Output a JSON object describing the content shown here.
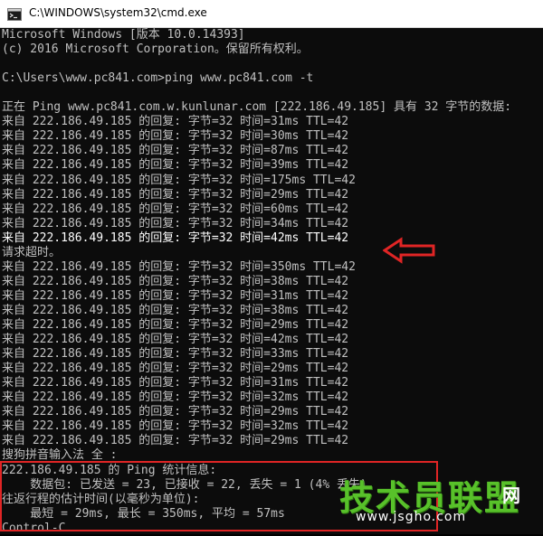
{
  "window": {
    "title": "C:\\WINDOWS\\system32\\cmd.exe",
    "icon": "cmd-icon"
  },
  "console_lines": [
    "Microsoft Windows [版本 10.0.14393]",
    "(c) 2016 Microsoft Corporation。保留所有权利。",
    "",
    "C:\\Users\\www.pc841.com>ping www.pc841.com -t",
    "",
    "正在 Ping www.pc841.com.w.kunlunar.com [222.186.49.185] 具有 32 字节的数据:",
    "来自 222.186.49.185 的回复: 字节=32 时间=31ms TTL=42",
    "来自 222.186.49.185 的回复: 字节=32 时间=30ms TTL=42",
    "来自 222.186.49.185 的回复: 字节=32 时间=87ms TTL=42",
    "来自 222.186.49.185 的回复: 字节=32 时间=39ms TTL=42",
    "来自 222.186.49.185 的回复: 字节=32 时间=175ms TTL=42",
    "来自 222.186.49.185 的回复: 字节=32 时间=29ms TTL=42",
    "来自 222.186.49.185 的回复: 字节=32 时间=60ms TTL=42",
    "来自 222.186.49.185 的回复: 字节=32 时间=34ms TTL=42",
    "来自 222.186.49.185 的回复: 字节=32 时间=42ms TTL=42",
    "请求超时。",
    "来自 222.186.49.185 的回复: 字节=32 时间=350ms TTL=42",
    "来自 222.186.49.185 的回复: 字节=32 时间=38ms TTL=42",
    "来自 222.186.49.185 的回复: 字节=32 时间=31ms TTL=42",
    "来自 222.186.49.185 的回复: 字节=32 时间=38ms TTL=42",
    "来自 222.186.49.185 的回复: 字节=32 时间=29ms TTL=42",
    "来自 222.186.49.185 的回复: 字节=32 时间=42ms TTL=42",
    "来自 222.186.49.185 的回复: 字节=32 时间=33ms TTL=42",
    "来自 222.186.49.185 的回复: 字节=32 时间=29ms TTL=42",
    "来自 222.186.49.185 的回复: 字节=32 时间=31ms TTL=42",
    "来自 222.186.49.185 的回复: 字节=32 时间=32ms TTL=42",
    "来自 222.186.49.185 的回复: 字节=32 时间=29ms TTL=42",
    "来自 222.186.49.185 的回复: 字节=32 时间=32ms TTL=42",
    "来自 222.186.49.185 的回复: 字节=32 时间=29ms TTL=42",
    "搜狗拼音输入法 全 :",
    "222.186.49.185 的 Ping 统计信息:",
    "    数据包: 已发送 = 23, 已接收 = 22, 丢失 = 1 (4% 丢失),",
    "往返行程的估计时间(以毫秒为单位):",
    "    最短 = 29ms, 最长 = 350ms, 平均 = 57ms",
    "Control-C"
  ],
  "highlight_line_index": 14,
  "watermark": {
    "brand_text": "技术员联盟",
    "suffix": "网",
    "url": "www.jsgho.com"
  },
  "colors": {
    "console_bg": "#0c0c0c",
    "console_text": "#c0c0c0",
    "annotation_red": "#e02525",
    "watermark_green": "#58c12a"
  }
}
